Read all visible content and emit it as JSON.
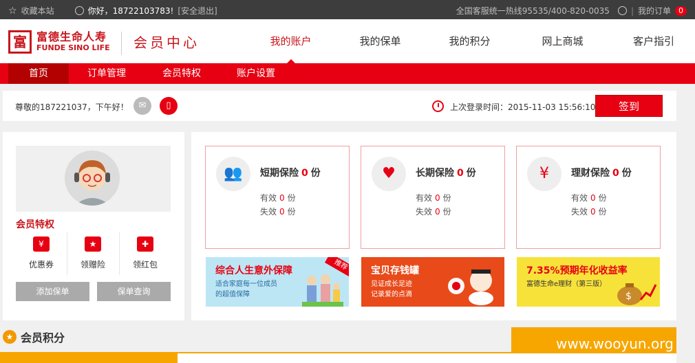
{
  "topbar": {
    "favorite": "收藏本站",
    "greeting": "你好，18722103783!",
    "logout": "[安全退出]",
    "hotline": "全国客服统一热线95535/400-820-0035",
    "sep": "|",
    "my_orders": "我的订单",
    "orders_count": "0"
  },
  "header": {
    "logo_char": "富",
    "brand_cn": "富德生命人寿",
    "brand_en": "FUNDE SINO LIFE",
    "member_center": "会员中心",
    "nav": [
      "我的账户",
      "我的保单",
      "我的积分",
      "网上商城",
      "客户指引"
    ]
  },
  "subnav": [
    "首页",
    "订单管理",
    "会员特权",
    "账户设置"
  ],
  "welcome": {
    "text": "尊敬的187221037，下午好！",
    "last_login_label": "上次登录时间：2015-11-03 15:56:10",
    "sign_in": "签到"
  },
  "profile": {
    "perks_title": "会员特权",
    "perks": [
      "优惠券",
      "领赠险",
      "领红包"
    ],
    "add_policy": "添加保单",
    "query_policy": "保单查询"
  },
  "insurance": [
    {
      "title": "短期保险",
      "count": "0",
      "unit": "份",
      "valid_label": "有效",
      "valid": "0",
      "invalid_label": "失效",
      "invalid": "0"
    },
    {
      "title": "长期保险",
      "count": "0",
      "unit": "份",
      "valid_label": "有效",
      "valid": "0",
      "invalid_label": "失效",
      "invalid": "0"
    },
    {
      "title": "理财保险",
      "count": "0",
      "unit": "份",
      "valid_label": "有效",
      "valid": "0",
      "invalid_label": "失效",
      "invalid": "0"
    }
  ],
  "banners": [
    {
      "title": "综合人生意外保障",
      "line1": "适合家庭每一位成员",
      "line2": "的超值保障",
      "tag": "推荐"
    },
    {
      "title": "宝贝存钱罐",
      "line1": "见证成长足迹",
      "line2": "记录爱的点滴"
    },
    {
      "title": "7.35%预期年化收益率",
      "line1": "富德生命e理财（第三版）",
      "line2": ""
    }
  ],
  "points": {
    "title": "会员积分"
  },
  "watermark": "www.wooyun.org",
  "colors": {
    "brand_red": "#e60012",
    "dark_bar": "#3d3d3d",
    "orange": "#f7a600"
  }
}
